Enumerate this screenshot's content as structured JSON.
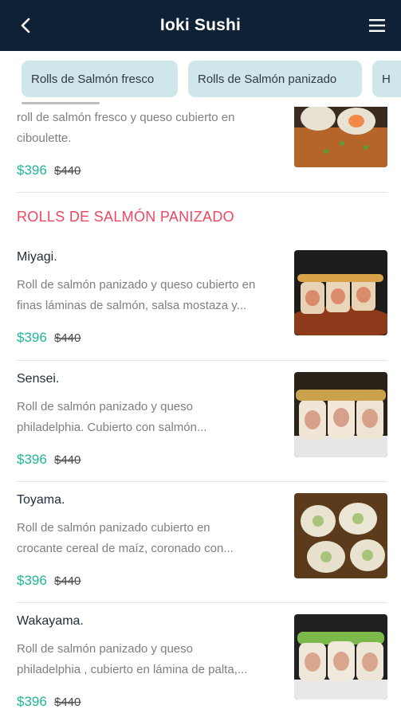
{
  "header": {
    "title": "Ioki Sushi",
    "back_icon": "chevron-left-icon",
    "menu_icon": "hamburger-menu-icon"
  },
  "chips": [
    "Rolls de Salmón fresco",
    "Rolls de Salmón panizado",
    "H"
  ],
  "partial_item": {
    "desc_line1": "roll de salmón fresco y queso cubierto en",
    "desc_line2": "ciboulette.",
    "price": "$396",
    "old_price": "$440"
  },
  "section": {
    "title": "ROLLS DE SALMÓN PANIZADO"
  },
  "items": [
    {
      "name": "Miyagi.",
      "desc_line1": "Roll de salmón panizado y queso cubierto en",
      "desc_line2": "finas láminas de salmón, salsa mostaza y...",
      "price": "$396",
      "old_price": "$440"
    },
    {
      "name": "Sensei.",
      "desc_line1": "Roll de salmón panizado y queso",
      "desc_line2": "philadelphia. Cubierto con salmón...",
      "price": "$396",
      "old_price": "$440"
    },
    {
      "name": "Toyama.",
      "desc_line1": "Roll de salmón panizado cubierto en",
      "desc_line2": "crocante cereal de maíz, coronado con...",
      "price": "$396",
      "old_price": "$440"
    },
    {
      "name": "Wakayama.",
      "desc_line1": "Roll de salmón panizado y queso",
      "desc_line2": "philadelphia , cubierto en lámina de palta,...",
      "price": "$396",
      "old_price": "$440"
    }
  ],
  "colors": {
    "header_bg": "#0f2137",
    "chip_bg": "#cfe7ea",
    "price": "#21b59a",
    "section_title": "#f0475f"
  }
}
